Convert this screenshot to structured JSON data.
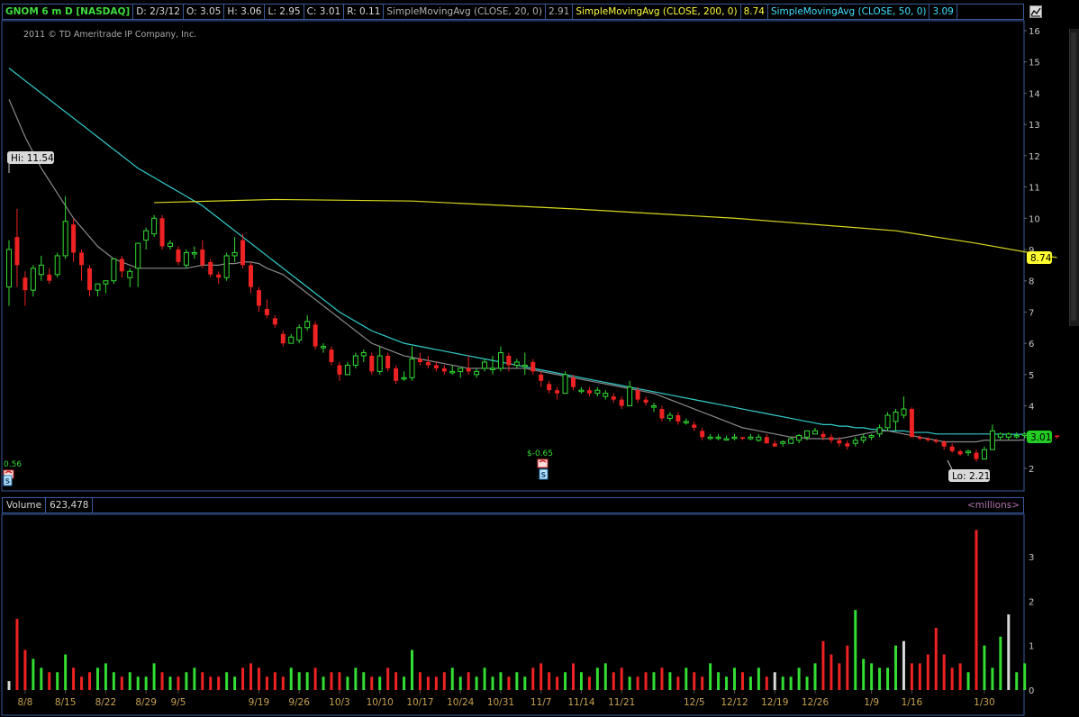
{
  "header": {
    "symbol": "GNOM 6 m D [NASDAQ]",
    "date": "D: 2/3/12",
    "open": "O: 3.05",
    "high": "H: 3.06",
    "low": "L: 2.95",
    "close": "C: 3.01",
    "range": "R: 0.11",
    "sma20_label": "SimpleMovingAvg (CLOSE, 20, 0)",
    "sma20_value": "2.91",
    "sma200_label": "SimpleMovingAvg (CLOSE, 200, 0)",
    "sma200_value": "8.74",
    "sma50_label": "SimpleMovingAvg (CLOSE, 50, 0)",
    "sma50_value": "3.09"
  },
  "copyright": "2011 © TD Ameritrade IP Company, Inc.",
  "volume_header": {
    "label": "Volume",
    "value": "623,478",
    "units": "<millions>"
  },
  "colors": {
    "up": "#33dd33",
    "down": "#ee2222",
    "flat": "#d8d8d8",
    "sma20": "#8a8a8a",
    "sma50": "#33cccc",
    "sma200": "#d8d820",
    "grid_border": "#3a5a9a"
  },
  "icons": [
    "chart-settings-icon",
    "earnings-phone-icon",
    "dividend-icon"
  ],
  "chart_data": {
    "type": "candlestick",
    "price_axis": {
      "ylim": [
        1.5,
        16.3
      ],
      "ticks": [
        2,
        3,
        4,
        5,
        6,
        7,
        8,
        9,
        10,
        11,
        12,
        13,
        14,
        15,
        16
      ]
    },
    "volume_axis": {
      "ylim": [
        0,
        3.8
      ],
      "ticks": [
        0,
        1,
        2,
        3
      ]
    },
    "x_ticks": [
      {
        "label": "8/8",
        "i": 2
      },
      {
        "label": "8/15",
        "i": 7
      },
      {
        "label": "8/22",
        "i": 12
      },
      {
        "label": "8/29",
        "i": 17
      },
      {
        "label": "9/5",
        "i": 21
      },
      {
        "label": "9/19",
        "i": 31
      },
      {
        "label": "9/26",
        "i": 36
      },
      {
        "label": "10/3",
        "i": 41
      },
      {
        "label": "10/10",
        "i": 46
      },
      {
        "label": "10/17",
        "i": 51
      },
      {
        "label": "10/24",
        "i": 56
      },
      {
        "label": "10/31",
        "i": 61
      },
      {
        "label": "11/7",
        "i": 66
      },
      {
        "label": "11/14",
        "i": 71
      },
      {
        "label": "11/21",
        "i": 76
      },
      {
        "label": "12/5",
        "i": 85
      },
      {
        "label": "12/12",
        "i": 90
      },
      {
        "label": "12/19",
        "i": 95
      },
      {
        "label": "12/26",
        "i": 100
      },
      {
        "label": "1/9",
        "i": 107
      },
      {
        "label": "1/16",
        "i": 112
      },
      {
        "label": "1/30",
        "i": 121
      }
    ],
    "candles": [
      [
        7.8,
        9.3,
        7.2,
        9.0
      ],
      [
        9.4,
        10.3,
        7.8,
        8.5
      ],
      [
        8.1,
        8.3,
        7.2,
        7.7
      ],
      [
        7.7,
        8.5,
        7.5,
        8.4
      ],
      [
        8.2,
        8.8,
        8.0,
        8.5
      ],
      [
        8.2,
        8.4,
        7.9,
        8.0
      ],
      [
        8.2,
        8.9,
        8.1,
        8.8
      ],
      [
        8.8,
        10.7,
        8.7,
        9.9
      ],
      [
        9.8,
        10.0,
        8.6,
        8.9
      ],
      [
        8.9,
        9.0,
        8.0,
        8.5
      ],
      [
        8.4,
        8.5,
        7.5,
        7.7
      ],
      [
        7.7,
        7.9,
        7.5,
        7.9
      ],
      [
        7.9,
        8.0,
        7.6,
        8.0
      ],
      [
        8.0,
        8.6,
        7.9,
        8.7
      ],
      [
        8.7,
        8.8,
        8.1,
        8.3
      ],
      [
        8.1,
        8.4,
        7.8,
        8.3
      ],
      [
        8.4,
        9.2,
        7.8,
        9.2
      ],
      [
        9.3,
        9.7,
        9.0,
        9.6
      ],
      [
        9.5,
        10.1,
        9.4,
        10.0
      ],
      [
        10.0,
        10.1,
        9.0,
        9.1
      ],
      [
        9.1,
        9.3,
        9.0,
        9.2
      ],
      [
        9.0,
        9.1,
        8.5,
        8.6
      ],
      [
        8.5,
        9.0,
        8.4,
        8.9
      ],
      [
        8.9,
        9.1,
        8.7,
        8.9
      ],
      [
        9.0,
        9.3,
        8.4,
        8.5
      ],
      [
        8.6,
        8.7,
        8.1,
        8.2
      ],
      [
        8.2,
        8.3,
        7.9,
        8.1
      ],
      [
        8.1,
        8.9,
        8.0,
        8.8
      ],
      [
        8.8,
        9.4,
        8.6,
        8.9
      ],
      [
        9.3,
        9.5,
        8.4,
        8.5
      ],
      [
        8.5,
        8.6,
        7.6,
        7.8
      ],
      [
        7.7,
        7.8,
        7.0,
        7.2
      ],
      [
        7.1,
        7.4,
        6.8,
        6.9
      ],
      [
        6.8,
        6.9,
        6.5,
        6.6
      ],
      [
        6.3,
        6.4,
        5.9,
        6.0
      ],
      [
        6.0,
        6.3,
        6.0,
        6.2
      ],
      [
        6.1,
        6.6,
        6.0,
        6.5
      ],
      [
        6.5,
        6.9,
        6.4,
        6.7
      ],
      [
        6.6,
        6.7,
        5.8,
        5.9
      ],
      [
        5.9,
        6.0,
        5.7,
        5.9
      ],
      [
        5.8,
        5.9,
        5.3,
        5.4
      ],
      [
        5.3,
        5.4,
        4.8,
        5.0
      ],
      [
        5.0,
        5.4,
        5.0,
        5.3
      ],
      [
        5.3,
        5.7,
        5.2,
        5.6
      ],
      [
        5.6,
        5.8,
        5.4,
        5.7
      ],
      [
        5.6,
        5.7,
        5.0,
        5.1
      ],
      [
        5.1,
        5.9,
        5.0,
        5.6
      ],
      [
        5.6,
        5.7,
        5.1,
        5.2
      ],
      [
        5.2,
        5.3,
        4.7,
        4.8
      ],
      [
        4.9,
        5.1,
        4.8,
        4.9
      ],
      [
        4.9,
        5.9,
        4.8,
        5.5
      ],
      [
        5.5,
        5.7,
        5.3,
        5.4
      ],
      [
        5.4,
        5.6,
        5.2,
        5.3
      ],
      [
        5.3,
        5.4,
        5.1,
        5.2
      ],
      [
        5.2,
        5.3,
        5.0,
        5.1
      ],
      [
        5.1,
        5.3,
        5.0,
        5.1
      ],
      [
        5.1,
        5.2,
        4.9,
        5.2
      ],
      [
        5.2,
        5.6,
        5.0,
        5.1
      ],
      [
        5.0,
        5.2,
        4.9,
        5.1
      ],
      [
        5.2,
        5.5,
        5.1,
        5.4
      ],
      [
        5.2,
        5.6,
        5.0,
        5.2
      ],
      [
        5.2,
        5.9,
        5.1,
        5.7
      ],
      [
        5.6,
        5.7,
        5.1,
        5.3
      ],
      [
        5.3,
        5.5,
        5.2,
        5.4
      ],
      [
        5.3,
        5.7,
        5.0,
        5.3
      ],
      [
        5.4,
        5.5,
        5.0,
        5.1
      ],
      [
        5.0,
        5.1,
        4.6,
        4.8
      ],
      [
        4.7,
        4.8,
        4.4,
        4.5
      ],
      [
        4.5,
        4.6,
        4.2,
        4.4
      ],
      [
        4.4,
        5.1,
        4.4,
        5.0
      ],
      [
        4.9,
        5.0,
        4.5,
        4.6
      ],
      [
        4.5,
        4.6,
        4.4,
        4.5
      ],
      [
        4.5,
        4.6,
        4.3,
        4.4
      ],
      [
        4.4,
        4.6,
        4.3,
        4.5
      ],
      [
        4.3,
        4.5,
        4.2,
        4.4
      ],
      [
        4.3,
        4.4,
        4.1,
        4.2
      ],
      [
        4.2,
        4.3,
        3.9,
        4.0
      ],
      [
        4.0,
        4.8,
        4.0,
        4.6
      ],
      [
        4.5,
        4.6,
        4.1,
        4.2
      ],
      [
        4.2,
        4.3,
        4.0,
        4.1
      ],
      [
        4.0,
        4.1,
        3.8,
        4.0
      ],
      [
        3.9,
        4.0,
        3.5,
        3.6
      ],
      [
        3.6,
        3.8,
        3.5,
        3.7
      ],
      [
        3.7,
        3.8,
        3.4,
        3.5
      ],
      [
        3.5,
        3.6,
        3.4,
        3.5
      ],
      [
        3.4,
        3.5,
        3.2,
        3.3
      ],
      [
        3.2,
        3.3,
        2.9,
        3.0
      ],
      [
        3.0,
        3.1,
        2.9,
        3.0
      ],
      [
        3.0,
        3.1,
        2.9,
        3.0
      ],
      [
        2.95,
        3.05,
        2.9,
        2.95
      ],
      [
        3.0,
        3.1,
        2.9,
        3.0
      ],
      [
        3.0,
        3.0,
        2.9,
        2.95
      ],
      [
        2.95,
        3.1,
        2.9,
        3.0
      ],
      [
        2.9,
        3.1,
        2.85,
        3.0
      ],
      [
        3.0,
        3.1,
        2.8,
        2.8
      ],
      [
        2.8,
        2.9,
        2.7,
        2.7
      ],
      [
        2.8,
        2.9,
        2.7,
        2.85
      ],
      [
        2.8,
        3.0,
        2.8,
        2.95
      ],
      [
        2.9,
        3.1,
        2.8,
        3.05
      ],
      [
        3.0,
        3.2,
        2.9,
        3.2
      ],
      [
        3.1,
        3.3,
        3.1,
        3.2
      ],
      [
        3.1,
        3.2,
        2.9,
        3.0
      ],
      [
        3.0,
        3.1,
        2.8,
        2.9
      ],
      [
        2.9,
        3.0,
        2.7,
        2.8
      ],
      [
        2.8,
        2.9,
        2.6,
        2.7
      ],
      [
        2.8,
        3.0,
        2.7,
        2.9
      ],
      [
        2.9,
        3.1,
        2.8,
        3.0
      ],
      [
        3.0,
        3.1,
        2.9,
        3.05
      ],
      [
        3.1,
        3.4,
        3.0,
        3.3
      ],
      [
        3.3,
        3.8,
        3.2,
        3.7
      ],
      [
        3.5,
        3.9,
        3.2,
        3.8
      ],
      [
        3.7,
        4.3,
        3.6,
        3.9
      ],
      [
        3.9,
        3.95,
        3.0,
        3.0
      ],
      [
        3.0,
        3.05,
        2.9,
        2.95
      ],
      [
        2.95,
        3.0,
        2.85,
        2.9
      ],
      [
        2.9,
        2.95,
        2.8,
        2.85
      ],
      [
        2.85,
        2.9,
        2.6,
        2.7
      ],
      [
        2.7,
        2.8,
        2.5,
        2.55
      ],
      [
        2.55,
        2.6,
        2.4,
        2.45
      ],
      [
        2.5,
        2.6,
        2.4,
        2.55
      ],
      [
        2.5,
        2.6,
        2.21,
        2.3
      ],
      [
        2.3,
        2.7,
        2.3,
        2.6
      ],
      [
        2.6,
        3.4,
        2.6,
        3.2
      ],
      [
        3.0,
        3.15,
        2.9,
        3.1
      ],
      [
        3.0,
        3.15,
        2.9,
        3.1
      ],
      [
        3.05,
        3.15,
        2.95,
        3.05
      ],
      [
        3.05,
        3.15,
        2.95,
        3.1
      ],
      [
        3.05,
        3.1,
        2.95,
        3.05
      ],
      [
        3.0,
        3.1,
        2.95,
        3.1
      ],
      [
        3.05,
        3.1,
        2.95,
        3.0
      ],
      [
        3.05,
        3.06,
        2.95,
        3.01
      ]
    ],
    "volume": [
      0.2,
      1.6,
      0.9,
      0.7,
      0.5,
      0.4,
      0.4,
      0.8,
      0.5,
      0.3,
      0.4,
      0.5,
      0.6,
      0.4,
      0.3,
      0.4,
      0.3,
      0.3,
      0.6,
      0.4,
      0.3,
      0.3,
      0.4,
      0.5,
      0.4,
      0.3,
      0.3,
      0.4,
      0.3,
      0.5,
      0.6,
      0.5,
      0.3,
      0.4,
      0.3,
      0.5,
      0.4,
      0.4,
      0.5,
      0.3,
      0.4,
      0.4,
      0.3,
      0.5,
      0.4,
      0.3,
      0.3,
      0.5,
      0.4,
      0.3,
      0.9,
      0.4,
      0.3,
      0.3,
      0.4,
      0.5,
      0.3,
      0.4,
      0.3,
      0.5,
      0.3,
      0.4,
      0.3,
      0.4,
      0.3,
      0.5,
      0.6,
      0.4,
      0.3,
      0.4,
      0.6,
      0.4,
      0.3,
      0.5,
      0.6,
      0.4,
      0.5,
      0.3,
      0.3,
      0.4,
      0.4,
      0.5,
      0.4,
      0.3,
      0.5,
      0.4,
      0.3,
      0.6,
      0.4,
      0.3,
      0.5,
      0.4,
      0.3,
      0.5,
      0.3,
      0.4,
      0.3,
      0.3,
      0.5,
      0.3,
      0.6,
      1.1,
      0.8,
      0.6,
      1.0,
      1.8,
      0.7,
      0.6,
      0.5,
      0.5,
      1.0,
      1.1,
      0.6,
      0.6,
      0.8,
      1.4,
      0.8,
      0.5,
      0.6,
      0.4,
      3.6,
      1.0,
      0.5,
      1.2,
      1.7,
      0.4,
      0.6
    ],
    "volume_tags": [
      {
        "i": 0,
        "flat": true
      },
      {
        "i": 95,
        "flat": true
      },
      {
        "i": 111,
        "flat": true
      },
      {
        "i": 124,
        "flat": true
      }
    ],
    "sma20": [
      13.8,
      13.2,
      12.6,
      12.1,
      11.6,
      11.2,
      10.8,
      10.4,
      10.0,
      9.7,
      9.4,
      9.1,
      8.9,
      8.7,
      8.6,
      8.5,
      8.4,
      8.4,
      8.4,
      8.4,
      8.4,
      8.4,
      8.4,
      8.45,
      8.5,
      8.5,
      8.5,
      8.55,
      8.55,
      8.6,
      8.6,
      8.55,
      8.4,
      8.3,
      8.2,
      8.0,
      7.8,
      7.6,
      7.4,
      7.2,
      7.0,
      6.8,
      6.6,
      6.4,
      6.2,
      6.0,
      5.9,
      5.8,
      5.7,
      5.6,
      5.55,
      5.5,
      5.45,
      5.4,
      5.35,
      5.3,
      5.25,
      5.2,
      5.2,
      5.2,
      5.2,
      5.2,
      5.2,
      5.2,
      5.2,
      5.15,
      5.1,
      5.05,
      5.0,
      4.95,
      4.9,
      4.85,
      4.8,
      4.75,
      4.7,
      4.65,
      4.6,
      4.55,
      4.5,
      4.45,
      4.4,
      4.3,
      4.2,
      4.1,
      4.0,
      3.9,
      3.8,
      3.7,
      3.6,
      3.5,
      3.4,
      3.3,
      3.25,
      3.2,
      3.15,
      3.1,
      3.05,
      3.0,
      3.0,
      2.95,
      2.95,
      2.95,
      2.95,
      2.95,
      3.0,
      3.05,
      3.1,
      3.15,
      3.2,
      3.2,
      3.15,
      3.1,
      3.05,
      3.0,
      2.95,
      2.9,
      2.85,
      2.85,
      2.85,
      2.85,
      2.85,
      2.9,
      2.9,
      2.9,
      2.9,
      2.9,
      2.91
    ],
    "sma50": [
      14.8,
      14.6,
      14.4,
      14.2,
      14.0,
      13.8,
      13.6,
      13.4,
      13.2,
      13.0,
      12.8,
      12.6,
      12.4,
      12.2,
      12.0,
      11.8,
      11.6,
      11.45,
      11.3,
      11.15,
      11.0,
      10.85,
      10.7,
      10.55,
      10.4,
      10.2,
      10.0,
      9.8,
      9.6,
      9.4,
      9.2,
      9.0,
      8.8,
      8.6,
      8.4,
      8.2,
      8.0,
      7.8,
      7.6,
      7.4,
      7.2,
      7.0,
      6.85,
      6.7,
      6.55,
      6.4,
      6.3,
      6.2,
      6.1,
      6.0,
      5.95,
      5.9,
      5.85,
      5.8,
      5.75,
      5.7,
      5.65,
      5.6,
      5.55,
      5.5,
      5.45,
      5.4,
      5.35,
      5.3,
      5.25,
      5.2,
      5.15,
      5.1,
      5.05,
      5.0,
      4.95,
      4.9,
      4.85,
      4.8,
      4.75,
      4.7,
      4.65,
      4.6,
      4.55,
      4.5,
      4.45,
      4.4,
      4.35,
      4.3,
      4.25,
      4.2,
      4.15,
      4.1,
      4.05,
      4.0,
      3.95,
      3.9,
      3.85,
      3.8,
      3.75,
      3.7,
      3.65,
      3.6,
      3.55,
      3.5,
      3.45,
      3.4,
      3.4,
      3.35,
      3.35,
      3.3,
      3.3,
      3.25,
      3.25,
      3.2,
      3.2,
      3.2,
      3.15,
      3.15,
      3.15,
      3.1,
      3.1,
      3.1,
      3.1,
      3.1,
      3.1,
      3.1,
      3.1,
      3.09,
      3.09,
      3.09,
      3.09
    ],
    "sma200": {
      "start_i": 18,
      "start": 10.5,
      "mid": [
        [
          33,
          10.6
        ],
        [
          50,
          10.55
        ],
        [
          70,
          10.3
        ],
        [
          90,
          10.0
        ],
        [
          110,
          9.6
        ],
        [
          120,
          9.2
        ]
      ],
      "end": 8.74
    },
    "labels": {
      "hi": "Hi: 11.54",
      "lo": "Lo: 2.21",
      "last_sma200": "8.74",
      "last_close": "3.01",
      "event1_value": "0.56",
      "event2_value": "$-0.65"
    }
  }
}
